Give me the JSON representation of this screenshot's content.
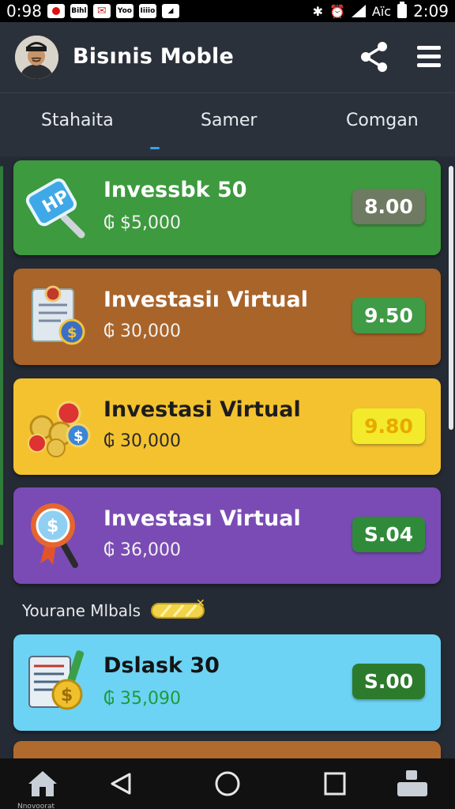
{
  "status_bar": {
    "time_left": "0:98",
    "sig_label": "Bihl",
    "mail_label": "✉",
    "box1": "Yoo",
    "box2": "Iiiio",
    "box3": "◢",
    "network": "Aïc",
    "time_right": "2:09"
  },
  "header": {
    "title": "Bisınis Moble"
  },
  "tabs": [
    {
      "label": "Stahaita"
    },
    {
      "label": "Samer"
    },
    {
      "label": "Comgan"
    }
  ],
  "cards": [
    {
      "title": "Invessbk 50",
      "amount": "₲ $5,000",
      "price": "8.00",
      "icon": "magnifier-tag-icon"
    },
    {
      "title": "Investasiı Virtual",
      "amount": "₲ 30,000",
      "price": "9.50",
      "icon": "document-coin-icon"
    },
    {
      "title": "Investasi Virtual",
      "amount": "₲ 30,000",
      "price": "9.80",
      "icon": "coins-pile-icon"
    },
    {
      "title": "Investası Virtual",
      "amount": "₲ 36,000",
      "price": "S.04",
      "icon": "magnifier-coin-icon"
    },
    {
      "title": "Dslask 30",
      "amount": "₲ 35,090",
      "price": "S.00",
      "icon": "report-coin-icon"
    }
  ],
  "section_label": "Yourane Mlbals",
  "bottom_nav": {
    "home_caption": "Nnovoorat"
  },
  "colors": {
    "green_card": "#3d9a3e",
    "brown_card": "#a9642a",
    "yellow_card": "#f4c22f",
    "purple_card": "#7a4bb5",
    "cyan_card": "#6dd3f4"
  }
}
